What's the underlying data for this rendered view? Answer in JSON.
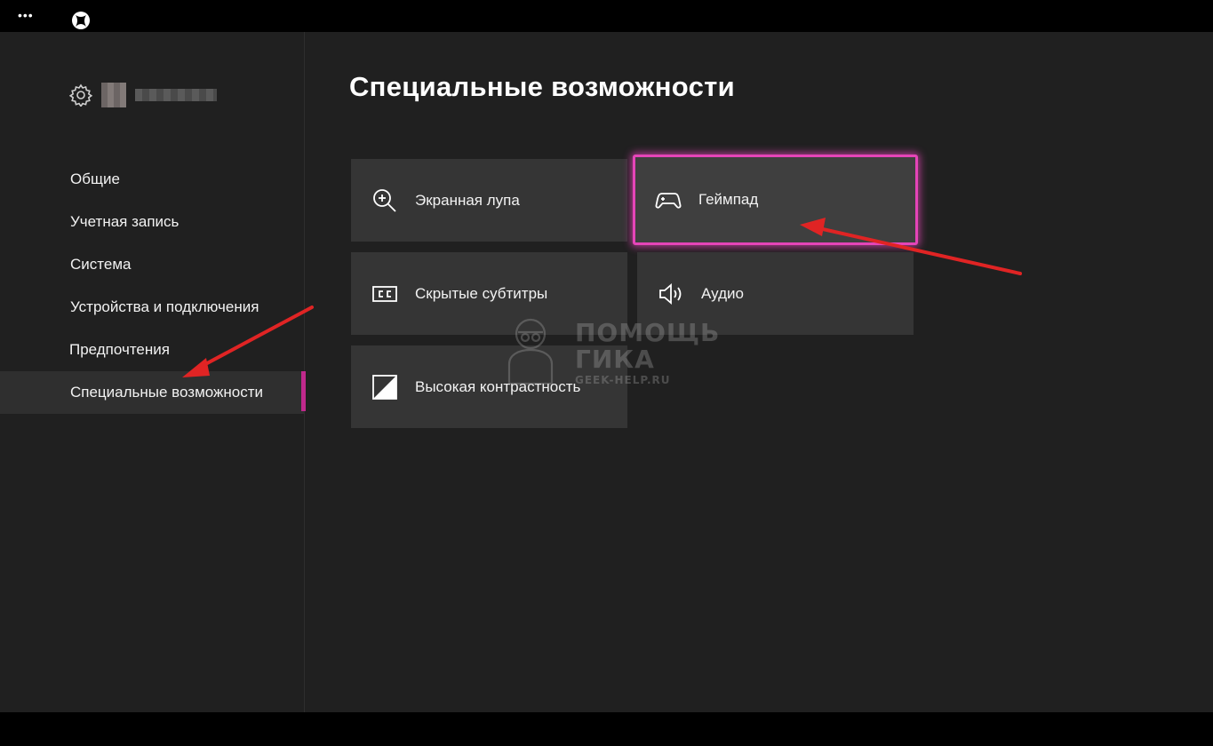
{
  "topbar": {
    "menu_icon": "more-dots-icon",
    "logo_icon": "xbox-logo-icon"
  },
  "sidebar": {
    "gear_icon": "gear-icon",
    "items": [
      {
        "label": "Общие"
      },
      {
        "label": "Учетная запись"
      },
      {
        "label": "Система"
      },
      {
        "label": "Устройства и подключения"
      },
      {
        "label": "Предпочтения"
      },
      {
        "label": "Специальные возможности",
        "active": true
      }
    ]
  },
  "main": {
    "title": "Специальные возможности",
    "tiles": [
      {
        "label": "Экранная лупа",
        "icon": "magnifier-icon"
      },
      {
        "label": "Геймпад",
        "icon": "gamepad-icon",
        "focused": true
      },
      {
        "label": "Скрытые субтитры",
        "icon": "closed-captions-icon"
      },
      {
        "label": "Аудио",
        "icon": "speaker-icon"
      },
      {
        "label": "Высокая контрастность",
        "icon": "high-contrast-icon"
      }
    ]
  },
  "watermark": {
    "line1": "ПОМОЩЬ",
    "line2": "ГИКА",
    "url": "GEEK-HELP.RU"
  },
  "colors": {
    "accent": "#c0298c",
    "focus_glow": "#e545b8",
    "annotation_arrow": "#e02424"
  }
}
